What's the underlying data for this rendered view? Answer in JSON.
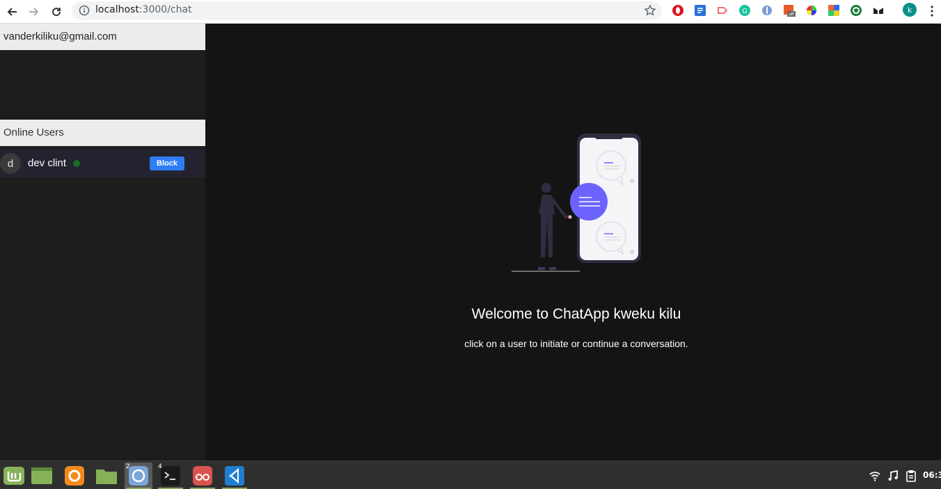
{
  "browser": {
    "url_host": "localhost",
    "url_path": ":3000/chat",
    "profile_initial": "k",
    "extensions": [
      "opera-icon",
      "screenshot-icon",
      "cast-icon",
      "grammarly-icon",
      "ext-icon",
      "colorzilla-off-icon",
      "color-wheel-icon",
      "palette-icon",
      "wappalyzer-icon",
      "glasses-icon"
    ],
    "extension_badge": "off"
  },
  "sidebar": {
    "current_user_email": "vanderkiliku@gmail.com",
    "online_header": "Online Users",
    "users": [
      {
        "initial": "d",
        "name": "dev clint",
        "status": "online",
        "action_label": "Block"
      }
    ]
  },
  "main": {
    "welcome_title": "Welcome to ChatApp kweku kilu",
    "welcome_subtitle": "click on a user to initiate or continue a conversation."
  },
  "taskbar": {
    "apps": [
      {
        "name": "mint-menu-icon",
        "badge": ""
      },
      {
        "name": "desktop-icon",
        "badge": ""
      },
      {
        "name": "firefox-icon",
        "badge": ""
      },
      {
        "name": "files-icon",
        "badge": ""
      },
      {
        "name": "chromium-icon",
        "badge": "2"
      },
      {
        "name": "terminal-icon",
        "badge": "4"
      },
      {
        "name": "xreader-icon",
        "badge": ""
      },
      {
        "name": "vscode-icon",
        "badge": ""
      }
    ],
    "clock": "06:3"
  },
  "colors": {
    "accent_blue": "#2f7df6",
    "online_green": "#1a6b2a",
    "illustration_purple": "#6c63ff"
  }
}
